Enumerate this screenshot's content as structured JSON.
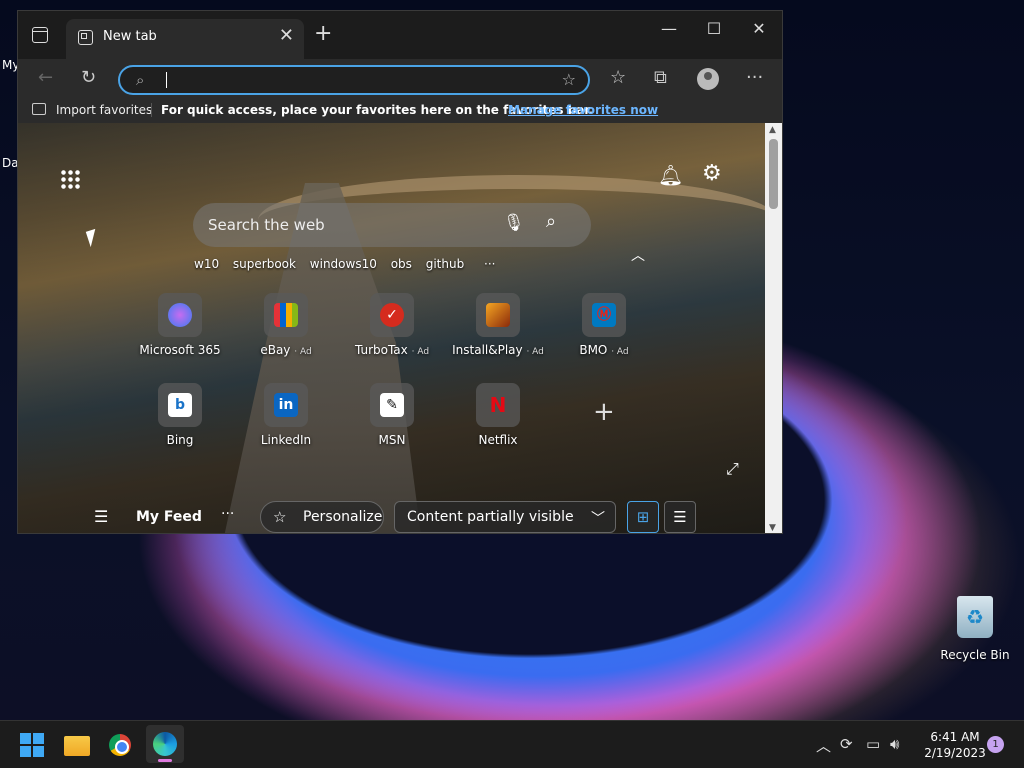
{
  "desktop": {
    "left_label_top": "My",
    "left_label_bottom": "Da",
    "recycle_bin_label": "Recycle Bin"
  },
  "browser": {
    "tab": {
      "title": "New tab",
      "close_glyph": "✕"
    },
    "new_tab_glyph": "+",
    "window_controls": {
      "minimize": "—",
      "maximize": "☐",
      "close": "✕"
    },
    "toolbar": {
      "back_glyph": "←",
      "refresh_glyph": "↻",
      "address_value": "",
      "favorites_glyph": "☆",
      "collections_glyph": "⧉",
      "more_glyph": "···"
    },
    "favorites_bar": {
      "import_label": "Import favorites",
      "hint": "For quick access, place your favorites here on the favorites bar.",
      "manage_link": "Manage favorites now"
    }
  },
  "newtab": {
    "search_placeholder": "Search the web",
    "quick_searches": [
      "w10",
      "superbook",
      "windows10",
      "obs",
      "github"
    ],
    "quick_more": "···",
    "tiles": [
      {
        "label": "Microsoft 365",
        "ad": "",
        "icon": "microsoft-365-icon",
        "color": "#7b61ff"
      },
      {
        "label": "eBay",
        "ad": "· Ad",
        "icon": "ebay-icon",
        "color": "#e53238"
      },
      {
        "label": "TurboTax",
        "ad": "· Ad",
        "icon": "turbotax-icon",
        "color": "#d52b1e"
      },
      {
        "label": "Install&Play",
        "ad": "· Ad",
        "icon": "install-play-icon",
        "color": "#b5651d"
      },
      {
        "label": "BMO",
        "ad": "· Ad",
        "icon": "bmo-icon",
        "color": "#0079c1"
      },
      {
        "label": "Bing",
        "ad": "",
        "icon": "bing-icon",
        "color": "#ffffff"
      },
      {
        "label": "LinkedIn",
        "ad": "",
        "icon": "linkedin-icon",
        "color": "#0a66c2"
      },
      {
        "label": "MSN",
        "ad": "",
        "icon": "msn-icon",
        "color": "#ffffff"
      },
      {
        "label": "Netflix",
        "ad": "",
        "icon": "netflix-icon",
        "color": "#e50914"
      }
    ],
    "feed": {
      "menu_glyph": "☰",
      "title": "My Feed",
      "dots": "···",
      "personalize": "Personalize",
      "content_visibility": "Content partially visible"
    }
  },
  "taskbar": {
    "clock_time": "6:41 AM",
    "clock_date": "2/19/2023",
    "notification_count": "1"
  }
}
